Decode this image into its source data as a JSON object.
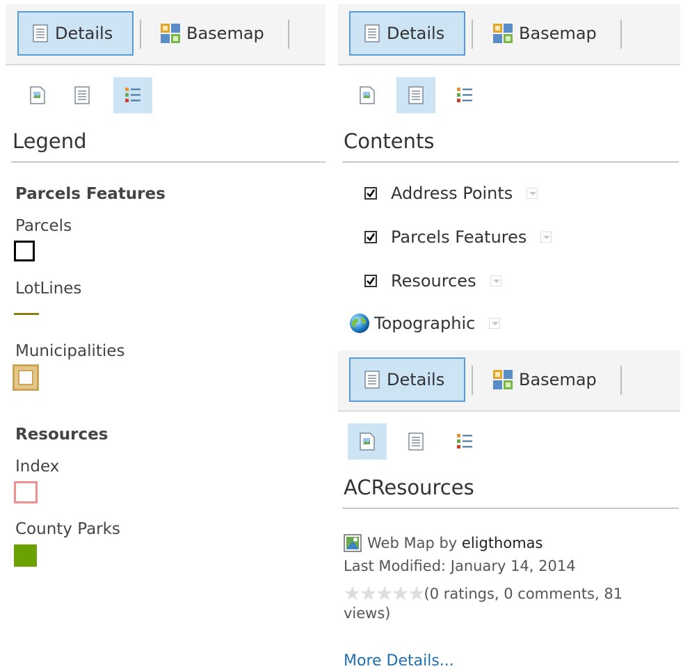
{
  "toolbar": {
    "details_label": "Details",
    "basemap_label": "Basemap"
  },
  "legend": {
    "title": "Legend",
    "groups": [
      {
        "title": "Parcels Features",
        "items": [
          {
            "label": "Parcels",
            "swatch": "outline-black"
          },
          {
            "label": "LotLines",
            "swatch": "line-olive"
          },
          {
            "label": "Municipalities",
            "swatch": "outline-tan"
          }
        ]
      },
      {
        "title": "Resources",
        "items": [
          {
            "label": "Index",
            "swatch": "outline-pink"
          },
          {
            "label": "County Parks",
            "swatch": "fill-green"
          }
        ]
      }
    ]
  },
  "contents": {
    "title": "Contents",
    "layers": [
      {
        "label": "Address Points",
        "checked": true
      },
      {
        "label": "Parcels Features",
        "checked": true
      },
      {
        "label": "Resources",
        "checked": true
      }
    ],
    "basemap_layer": {
      "label": "Topographic",
      "icon": "globe-icon"
    }
  },
  "details": {
    "title": "ACResources",
    "item_type": "Web Map by",
    "owner": "eligthomas",
    "modified": "Last Modified: January 14, 2014",
    "rating_text": "(0 ratings, 0 comments, 81",
    "rating_text_2": "views)",
    "stars": 0,
    "more_link": "More Details..."
  },
  "colors": {
    "accent": "#5b9bd5",
    "active_bg": "#cde4f5",
    "olive": "#8a7f10",
    "tan": "#d9b56b",
    "pink": "#f08f8f",
    "green": "#6ba100",
    "link": "#1f6fb2"
  }
}
